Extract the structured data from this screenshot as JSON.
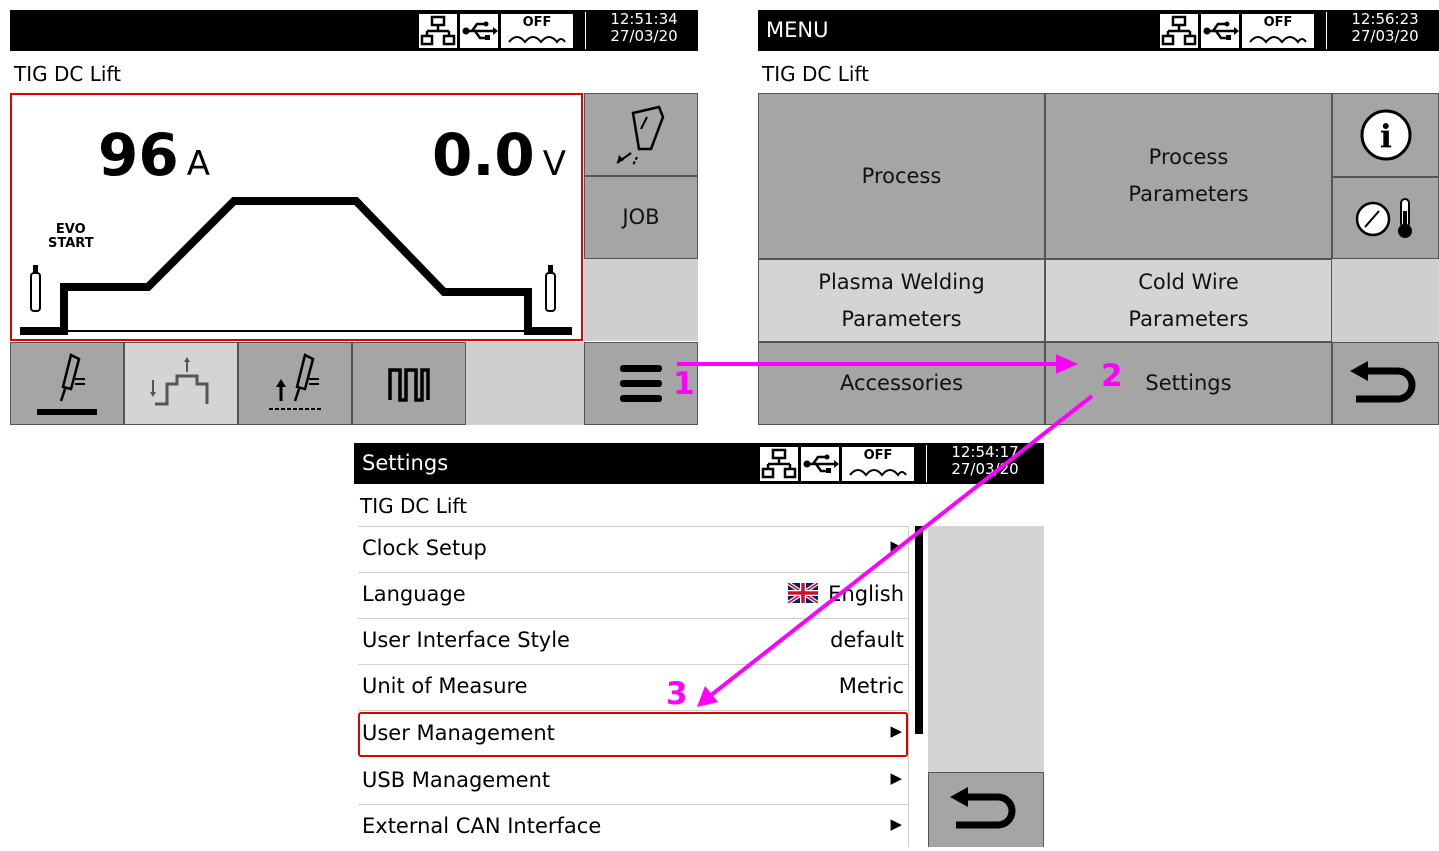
{
  "screen1": {
    "time": "12:51:34",
    "date": "27/03/20",
    "heat_label": "OFF",
    "process": "TIG DC Lift",
    "current_value": "96",
    "current_unit": "A",
    "voltage_value": "0.0",
    "voltage_unit": "V",
    "start_label_line1": "EVO",
    "start_label_line2": "START",
    "job_label": "JOB"
  },
  "screen2": {
    "title": "MENU",
    "time": "12:56:23",
    "date": "27/03/20",
    "heat_label": "OFF",
    "process": "TIG DC Lift",
    "buttons": {
      "process": "Process",
      "process_params_line1": "Process",
      "process_params_line2": "Parameters",
      "plasma_line1": "Plasma Welding",
      "plasma_line2": "Parameters",
      "coldwire_line1": "Cold Wire",
      "coldwire_line2": "Parameters",
      "accessories": "Accessories",
      "settings": "Settings"
    }
  },
  "screen3": {
    "title": "Settings",
    "time": "12:54:17",
    "date": "27/03/20",
    "heat_label": "OFF",
    "process": "TIG DC Lift",
    "rows": [
      {
        "label": "Clock Setup",
        "value": ""
      },
      {
        "label": "Language",
        "value": "English"
      },
      {
        "label": "User Interface Style",
        "value": "default"
      },
      {
        "label": "Unit of Measure",
        "value": "Metric"
      },
      {
        "label": "User Management",
        "value": ""
      },
      {
        "label": "USB Management",
        "value": ""
      },
      {
        "label": "External CAN Interface",
        "value": ""
      }
    ]
  },
  "annotations": {
    "step1": "1",
    "step2": "2",
    "step3": "3",
    "color": "#ff00ff"
  },
  "colors": {
    "highlight_red": "#e00000",
    "button_gray": "#a5a5a5",
    "light_gray": "#d4d4d4"
  }
}
